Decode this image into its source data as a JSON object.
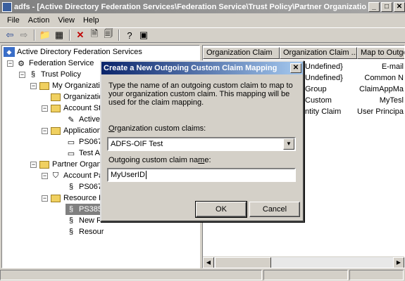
{
  "window": {
    "title": "adfs - [Active Directory Federation Services\\Federation Service\\Trust Policy\\Partner Organizatio..."
  },
  "menu": [
    "File",
    "Action",
    "View",
    "Help"
  ],
  "tree": {
    "root": "Active Directory Federation Services",
    "federation_service": "Federation Service",
    "trust_policy": "Trust Policy",
    "my_org": "My Organizatic",
    "organization": "Organizatio",
    "account_stores": "Account St",
    "active": "Active",
    "applications": "Application",
    "ps067": "PS067(",
    "test_app": "Test Ap",
    "partner_orgs": "Partner Organi",
    "account_partners": "Account Pa",
    "ps067b": "PS067(",
    "resource_partners": "Resource F",
    "ps385": "PS385(",
    "new_re": "New Re",
    "resour": "Resour"
  },
  "list": {
    "columns": [
      "Organization Claim",
      "Organization Claim ...",
      "Map to Outgoi"
    ],
    "rows": [
      [
        "",
        "Undefined}",
        "E-mail"
      ],
      [
        "",
        "Undefined}",
        "Common N"
      ],
      [
        "",
        "Group",
        "ClaimAppMa"
      ],
      [
        "",
        "Custom",
        "MyTesl"
      ],
      [
        "",
        "ntity Claim",
        "User Principa"
      ]
    ]
  },
  "dialog": {
    "title": "Create a New Outgoing Custom Claim Mapping",
    "instructions": "Type the name of an outgoing custom claim to map to your organization custom claim. This mapping will be used for the claim mapping.",
    "org_claims_label_prefix": "",
    "org_claims_label_hot": "O",
    "org_claims_label_rest": "rganization custom claims:",
    "org_claims_value": "ADFS-OIF Test",
    "outgoing_label_prefix": "Outgoing custom claim na",
    "outgoing_label_hot": "m",
    "outgoing_label_rest": "e:",
    "outgoing_value": "MyUserID",
    "ok_label": "OK",
    "cancel_label": "Cancel"
  }
}
